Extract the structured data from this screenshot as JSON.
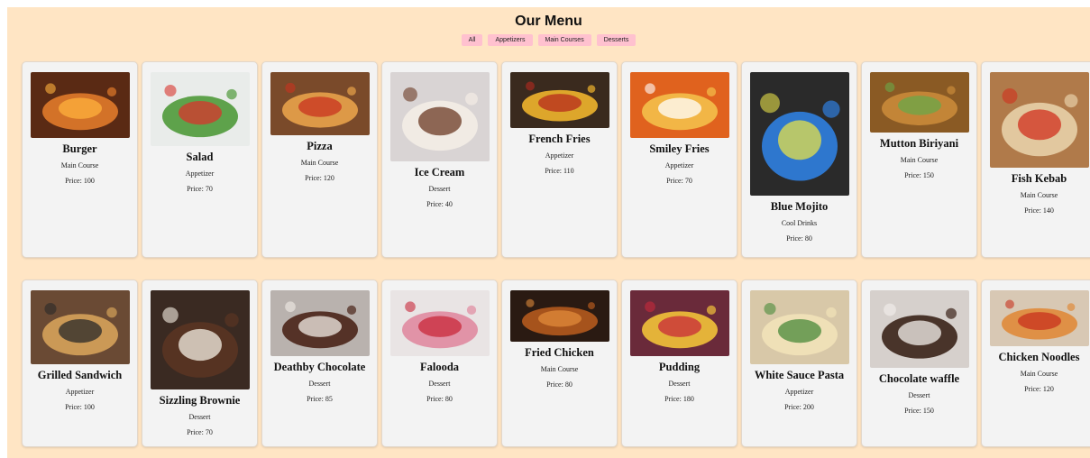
{
  "menu": {
    "title": "Our Menu",
    "filters": [
      "All",
      "Appetizers",
      "Main Courses",
      "Desserts"
    ],
    "rows": [
      [
        {
          "name": "Burger",
          "category": "Main Course",
          "price": "Price: 100",
          "img_h": 73,
          "bg": "#5a2a14",
          "fg": "#e07a2a",
          "accent": "#ffb23c"
        },
        {
          "name": "Salad",
          "category": "Appetizer",
          "price": "Price: 70",
          "img_h": 82,
          "bg": "#e9ecea",
          "fg": "#4f9a3a",
          "accent": "#d8342c"
        },
        {
          "name": "Pizza",
          "category": "Main Course",
          "price": "Price: 120",
          "img_h": 70,
          "bg": "#7a4a2a",
          "fg": "#e8a24a",
          "accent": "#c8331f"
        },
        {
          "name": "Ice Cream",
          "category": "Dessert",
          "price": "Price: 40",
          "img_h": 99,
          "bg": "#d9d4d4",
          "fg": "#f3ede6",
          "accent": "#6b3a24"
        },
        {
          "name": "French Fries",
          "category": "Appetizer",
          "price": "Price: 110",
          "img_h": 62,
          "bg": "#3a2a1e",
          "fg": "#f0b42c",
          "accent": "#b62a1e"
        },
        {
          "name": "Smiley Fries",
          "category": "Appetizer",
          "price": "Price: 70",
          "img_h": 73,
          "bg": "#e0621e",
          "fg": "#f4c04a",
          "accent": "#ffffff"
        },
        {
          "name": "Blue Mojito",
          "category": "Cool Drinks",
          "price": "Price: 80",
          "img_h": 137,
          "bg": "#2a2a2a",
          "fg": "#2f7fe0",
          "accent": "#e6e04a"
        },
        {
          "name": "Mutton Biriyani",
          "category": "Main Course",
          "price": "Price: 150",
          "img_h": 67,
          "bg": "#8a5a24",
          "fg": "#c98a3a",
          "accent": "#6aa84a"
        },
        {
          "name": "Fish Kebab",
          "category": "Main Course",
          "price": "Price: 140",
          "img_h": 106,
          "bg": "#b07a4a",
          "fg": "#e8d0a8",
          "accent": "#d0301e"
        }
      ],
      [
        {
          "name": "Grilled Sandwich",
          "category": "Appetizer",
          "price": "Price: 100",
          "img_h": 82,
          "bg": "#6a4a34",
          "fg": "#d6a25a",
          "accent": "#2a2a2a"
        },
        {
          "name": "Sizzling Brownie",
          "category": "Dessert",
          "price": "Price: 70",
          "img_h": 110,
          "bg": "#3a2a22",
          "fg": "#5a3422",
          "accent": "#f6f0e4"
        },
        {
          "name": "Deathby Chocolate",
          "category": "Dessert",
          "price": "Price: 85",
          "img_h": 73,
          "bg": "#b9b2ae",
          "fg": "#4a2418",
          "accent": "#f2ece6"
        },
        {
          "name": "Falooda",
          "category": "Dessert",
          "price": "Price: 80",
          "img_h": 73,
          "bg": "#e9e4e4",
          "fg": "#e08aa0",
          "accent": "#c8283a"
        },
        {
          "name": "Fried Chicken",
          "category": "Main Course",
          "price": "Price: 80",
          "img_h": 57,
          "bg": "#2a1a12",
          "fg": "#b45a1e",
          "accent": "#e08a3a"
        },
        {
          "name": "Pudding",
          "category": "Dessert",
          "price": "Price: 180",
          "img_h": 73,
          "bg": "#6a2a3a",
          "fg": "#f2c23a",
          "accent": "#c82a3a"
        },
        {
          "name": "White Sauce Pasta",
          "category": "Appetizer",
          "price": "Price: 200",
          "img_h": 82,
          "bg": "#d8c8a8",
          "fg": "#f2e2b8",
          "accent": "#4a8a3a"
        },
        {
          "name": "Chocolate waffle",
          "category": "Dessert",
          "price": "Price: 150",
          "img_h": 86,
          "bg": "#d6d0cc",
          "fg": "#3a2218",
          "accent": "#f4f0ec"
        },
        {
          "name": "Chicken Noodles",
          "category": "Main Course",
          "price": "Price: 120",
          "img_h": 62,
          "bg": "#d8c8b4",
          "fg": "#e08a3a",
          "accent": "#c8321e"
        }
      ]
    ]
  }
}
